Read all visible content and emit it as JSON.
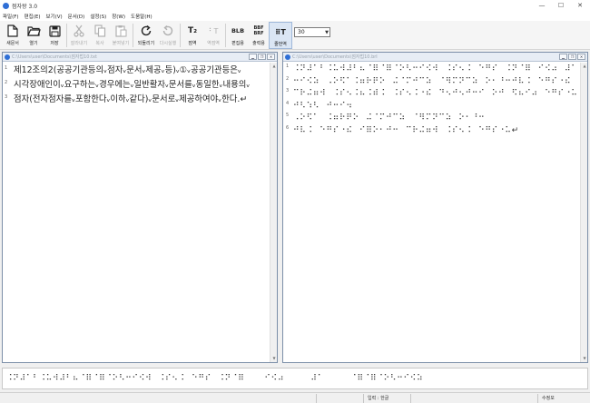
{
  "window": {
    "title": "점자왕 3.0",
    "controls": [
      "—",
      "☐",
      "✕"
    ]
  },
  "menu": [
    "파일(F)",
    "편집(E)",
    "보기(V)",
    "문서(D)",
    "설정(S)",
    "창(W)",
    "도움말(H)"
  ],
  "toolbar": {
    "buttons": [
      {
        "label": "새문서",
        "icon": "new-document-icon",
        "enabled": true
      },
      {
        "label": "열기",
        "icon": "open-folder-icon",
        "enabled": true
      },
      {
        "label": "저장",
        "icon": "save-icon",
        "enabled": true
      },
      {
        "label": "잘라내기",
        "icon": "cut-icon",
        "enabled": false
      },
      {
        "label": "복사",
        "icon": "copy-icon",
        "enabled": false
      },
      {
        "label": "붙여넣기",
        "icon": "paste-icon",
        "enabled": false
      },
      {
        "label": "되돌리기",
        "icon": "undo-icon",
        "enabled": true
      },
      {
        "label": "다시실행",
        "icon": "redo-icon",
        "enabled": false
      },
      {
        "label": "점역",
        "icon": "translate-icon",
        "enabled": true,
        "icon_text": "T₂"
      },
      {
        "label": "역점역",
        "icon": "reverse-translate-icon",
        "enabled": false,
        "icon_text": "⠃T"
      },
      {
        "label": "편집용",
        "icon": "edit-format-icon",
        "enabled": true,
        "icon_text": "BLB"
      },
      {
        "label": "출력용",
        "icon": "output-format-icon",
        "enabled": true,
        "icon_text": "BBF\nBRF"
      },
      {
        "label": "줄번역",
        "icon": "line-translate-icon",
        "enabled": true,
        "icon_text": "⠿T",
        "active": true
      }
    ],
    "font_size": "30"
  },
  "left_pane": {
    "path": "C:\\Users\\user\\Documents\\점자법10.txt",
    "line_numbers": [
      "1",
      "2",
      "3"
    ],
    "lines": [
      "제12조의2(공공기관등의ᵥ점자ᵥ문서ᵥ제공ᵥ등)ᵥ①ᵥ공공기관등은ᵥ",
      "시각장애인이ᵥ요구하는ᵥ경우에는ᵥ일반활자ᵥ문서를ᵥ동일한ᵥ내용의ᵥ",
      "점자(전자점자를ᵥ포함한다ᵥ이하ᵥ같다)ᵥ문서로ᵥ제공하여야ᵥ한다.↵"
    ]
  },
  "right_pane": {
    "path": "C:\\Users\\user\\Documents\\점자법10.brl",
    "line_numbers": [
      "1",
      "2",
      "3",
      "4",
      "5",
      "6"
    ],
    "lines": [
      "⠨⠝⠼⠁⠃⠨⠥⠺⠼⠃⠦⠈⠿⠈⠿⠈⠕⠣⠒⠊⠪⠺⠀⠨⠎⠢⠨⠀⠑⠛⠎⠀⠨⠝⠈⠿⠀⠊⠪⠴⠀⠼⠁⠀⠈⠿⠈⠿⠈⠕⠣",
      "⠒⠊⠪⠵⠀⠠⠕⠫⠁⠨⠶⠗⠟⠕⠀⠬⠈⠍⠚⠉⠵⠀⠈⠻⠍⠝⠉⠵⠀⠕⠂⠘⠒⠚⠧⠨⠀⠑⠛⠎⠐⠮⠀⠊⠿⠕⠂⠚⠒⠀",
      "⠉⠗⠬⠶⠺⠀⠨⠎⠢⠨⠦⠨⠾⠨⠀⠨⠎⠢⠨⠐⠮⠀⠙⠢⠚⠢⠚⠒⠊⠀⠕⠚⠀⠫⠦⠊⠴⠀⠑⠛⠎⠐⠥⠀⠨⠝⠈⠿",
      "⠚⠣⠱⠣⠀⠚⠒⠊⠲",
      "⠠⠕⠫⠁⠀⠨⠶⠗⠟⠕⠀⠬⠈⠍⠚⠉⠵⠀⠈⠻⠍⠝⠉⠵⠀⠕⠂⠘⠒",
      "⠚⠧⠨⠀⠑⠛⠎⠐⠮⠀⠊⠿⠕⠂⠚⠒⠀⠉⠗⠬⠶⠺⠀⠨⠎⠢⠨⠀⠑⠛⠎⠐⠥↵"
    ]
  },
  "braille_strip": "⠨⠝⠼⠁⠃⠨⠥⠺⠼⠃⠦⠈⠿⠈⠿⠈⠕⠣⠒⠊⠪⠺⠀⠨⠎⠢⠨⠀⠑⠛⠎⠀⠨⠝⠈⠿⠀⠀⠀⠊⠪⠴⠀⠀⠀⠀⠼⠁⠀⠀⠀⠀⠈⠿⠈⠿⠈⠕⠣⠒⠊⠪⠵",
  "status": {
    "input_mode": "입력 : 한글",
    "edit_mode": "수정모"
  }
}
